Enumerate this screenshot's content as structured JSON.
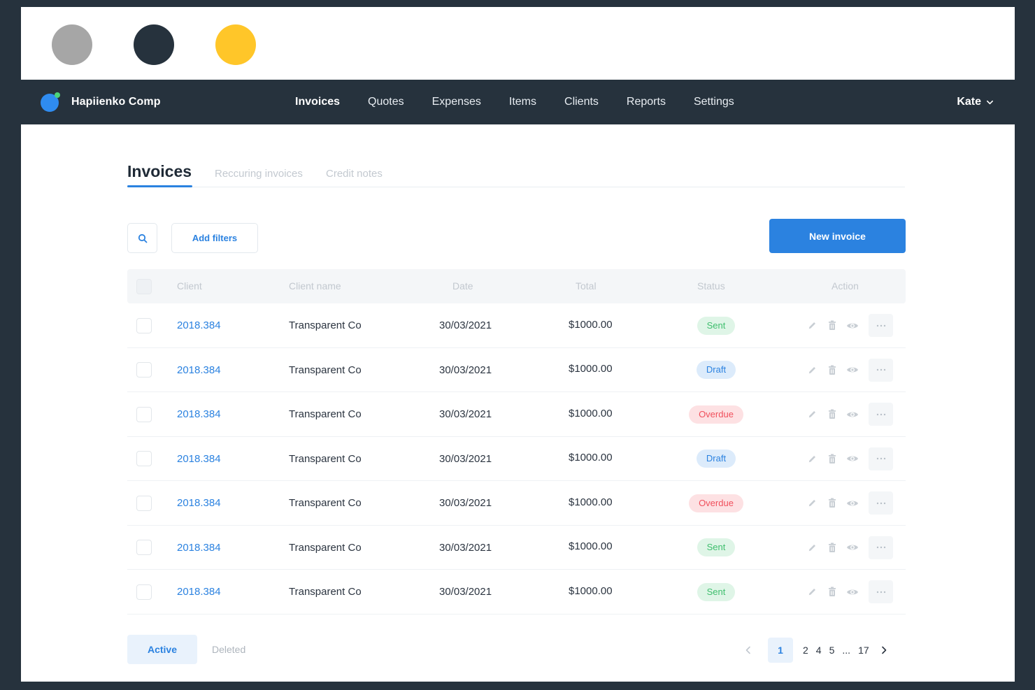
{
  "window": {
    "dots": [
      "#a6a6a6",
      "#26323d",
      "#ffc629"
    ]
  },
  "brand": {
    "name": "Hapiienko Comp"
  },
  "nav": {
    "items": [
      {
        "label": "Invoices",
        "active": true
      },
      {
        "label": "Quotes"
      },
      {
        "label": "Expenses"
      },
      {
        "label": "Items"
      },
      {
        "label": "Clients"
      },
      {
        "label": "Reports"
      },
      {
        "label": "Settings"
      }
    ],
    "user": "Kate"
  },
  "tabs": {
    "main": "Invoices",
    "recurring": "Reccuring invoices",
    "credit": "Credit notes"
  },
  "toolbar": {
    "filters_label": "Add filters",
    "new_label": "New invoice"
  },
  "table": {
    "headers": {
      "client": "Client",
      "client_name": "Client name",
      "date": "Date",
      "total": "Total",
      "status": "Status",
      "action": "Action"
    },
    "rows": [
      {
        "client": "2018.384",
        "name": "Transparent Co",
        "date": "30/03/2021",
        "total": "$1000.00",
        "status": "Sent",
        "kind": "sent"
      },
      {
        "client": "2018.384",
        "name": "Transparent Co",
        "date": "30/03/2021",
        "total": "$1000.00",
        "status": "Draft",
        "kind": "draft"
      },
      {
        "client": "2018.384",
        "name": "Transparent Co",
        "date": "30/03/2021",
        "total": "$1000.00",
        "status": "Overdue",
        "kind": "overdue"
      },
      {
        "client": "2018.384",
        "name": "Transparent Co",
        "date": "30/03/2021",
        "total": "$1000.00",
        "status": "Draft",
        "kind": "draft"
      },
      {
        "client": "2018.384",
        "name": "Transparent Co",
        "date": "30/03/2021",
        "total": "$1000.00",
        "status": "Overdue",
        "kind": "overdue"
      },
      {
        "client": "2018.384",
        "name": "Transparent Co",
        "date": "30/03/2021",
        "total": "$1000.00",
        "status": "Sent",
        "kind": "sent"
      },
      {
        "client": "2018.384",
        "name": "Transparent Co",
        "date": "30/03/2021",
        "total": "$1000.00",
        "status": "Sent",
        "kind": "sent"
      }
    ]
  },
  "footer": {
    "active_label": "Active",
    "deleted_label": "Deleted",
    "pagination": {
      "current": "1",
      "pages": [
        "2",
        "4",
        "5",
        "...",
        "17"
      ]
    }
  },
  "colors": {
    "accent": "#2b82e0",
    "nav_bg": "#26323d",
    "sent": "#3fbf6e",
    "draft": "#2b82e0",
    "overdue": "#f0505c"
  }
}
